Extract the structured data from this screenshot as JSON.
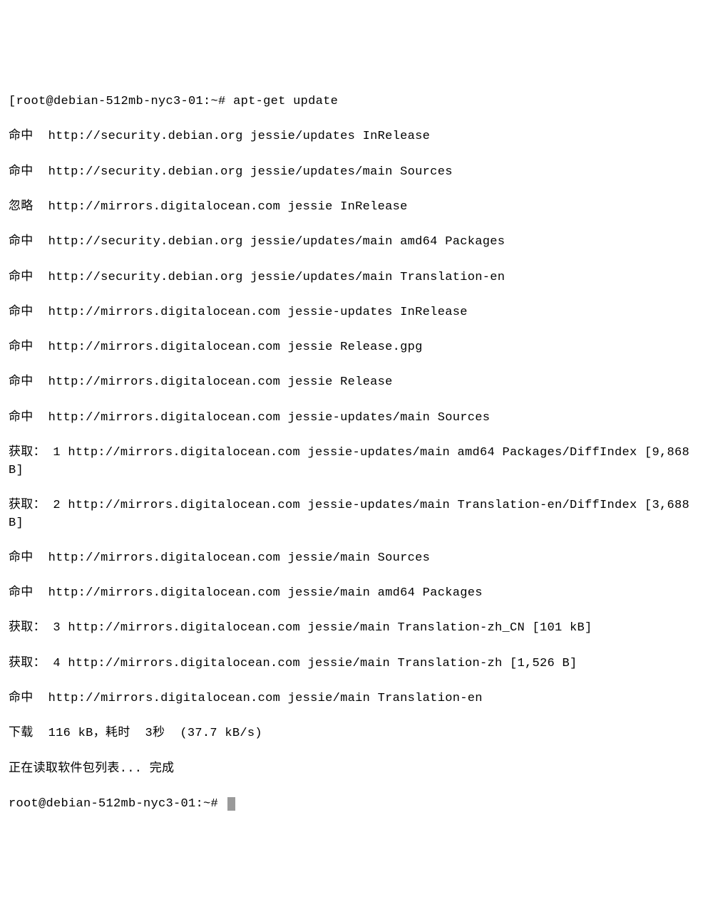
{
  "prompt1": "root@debian-512mb-nyc3-01:~# ",
  "command": "apt-get update",
  "lines": [
    "命中  http://security.debian.org jessie/updates InRelease",
    "命中  http://security.debian.org jessie/updates/main Sources",
    "忽略  http://mirrors.digitalocean.com jessie InRelease",
    "命中  http://security.debian.org jessie/updates/main amd64 Packages",
    "命中  http://security.debian.org jessie/updates/main Translation-en",
    "命中  http://mirrors.digitalocean.com jessie-updates InRelease",
    "命中  http://mirrors.digitalocean.com jessie Release.gpg",
    "命中  http://mirrors.digitalocean.com jessie Release",
    "命中  http://mirrors.digitalocean.com jessie-updates/main Sources",
    "获取： 1 http://mirrors.digitalocean.com jessie-updates/main amd64 Packages/DiffIndex [9,868 B]",
    "获取： 2 http://mirrors.digitalocean.com jessie-updates/main Translation-en/DiffIndex [3,688 B]",
    "命中  http://mirrors.digitalocean.com jessie/main Sources",
    "命中  http://mirrors.digitalocean.com jessie/main amd64 Packages",
    "获取： 3 http://mirrors.digitalocean.com jessie/main Translation-zh_CN [101 kB]",
    "获取： 4 http://mirrors.digitalocean.com jessie/main Translation-zh [1,526 B]",
    "命中  http://mirrors.digitalocean.com jessie/main Translation-en",
    "下载  116 kB，耗时  3秒  (37.7 kB/s)",
    "正在读取软件包列表... 完成"
  ],
  "prompt2": "root@debian-512mb-nyc3-01:~# "
}
